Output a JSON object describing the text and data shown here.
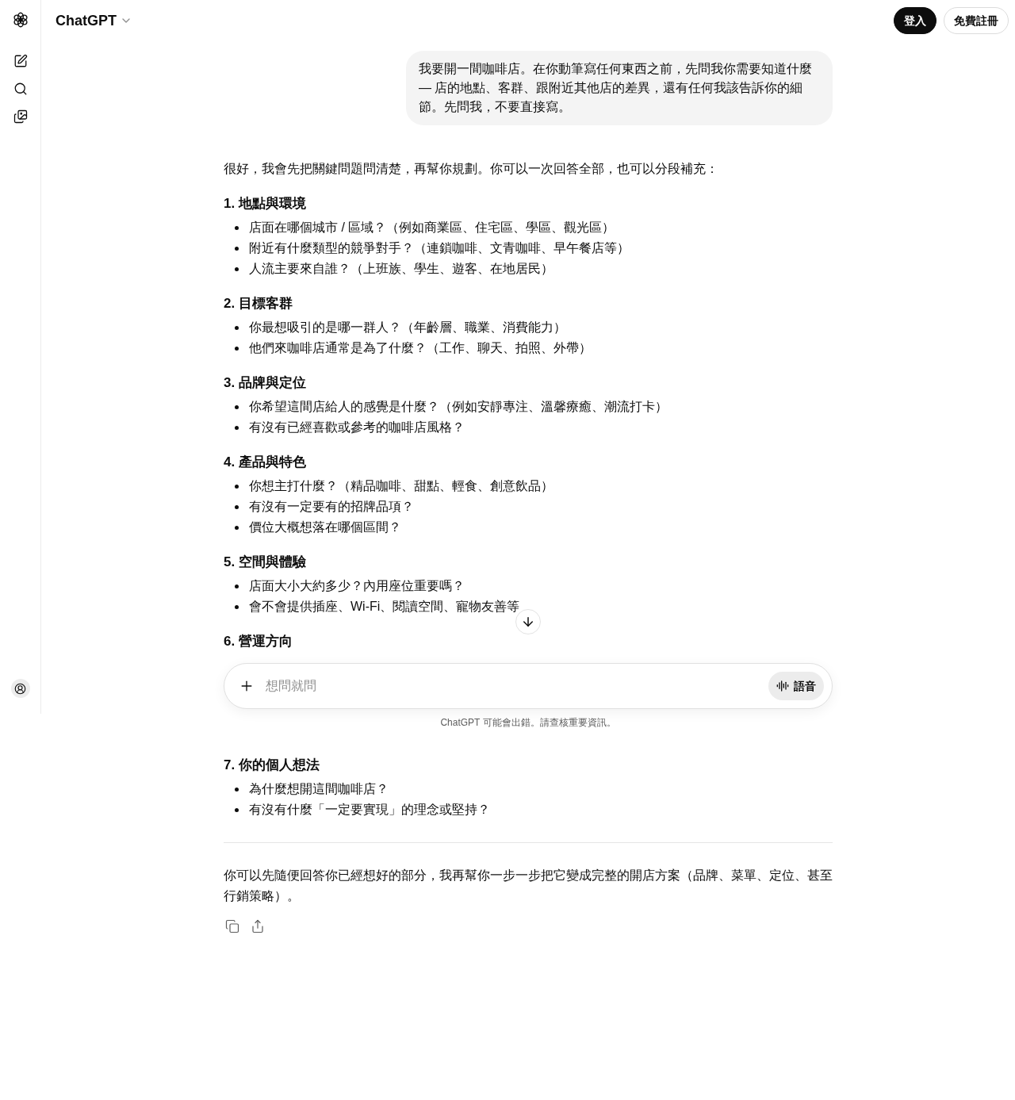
{
  "header": {
    "title": "ChatGPT",
    "buttons": [
      {
        "label": "登入",
        "kind": "primary"
      },
      {
        "label": "免費註冊",
        "kind": "secondary"
      }
    ]
  },
  "user_message": "我要開一間咖啡店。在你動筆寫任何東西之前，先問我你需要知道什麼 — 店的地點、客群、跟附近其他店的差異，還有任何我該告訴你的細節。先問我，不要直接寫。",
  "assistant": {
    "intro": "很好，我會先把關鍵問題問清楚，再幫你規劃。你可以一次回答全部，也可以分段補充：",
    "sections_above": [
      {
        "heading": "1. 地點與環境",
        "items": [
          "店面在哪個城市 / 區域？（例如商業區、住宅區、學區、觀光區）",
          "附近有什麼類型的競爭對手？（連鎖咖啡、文青咖啡、早午餐店等）",
          "人流主要來自誰？（上班族、學生、遊客、在地居民）"
        ]
      },
      {
        "heading": "2. 目標客群",
        "items": [
          "你最想吸引的是哪一群人？（年齡層、職業、消費能力）",
          "他們來咖啡店通常是為了什麼？（工作、聊天、拍照、外帶）"
        ]
      },
      {
        "heading": "3. 品牌與定位",
        "items": [
          "你希望這間店給人的感覺是什麼？（例如安靜專注、溫馨療癒、潮流打卡）",
          "有沒有已經喜歡或參考的咖啡店風格？"
        ]
      },
      {
        "heading": "4. 產品與特色",
        "items": [
          "你想主打什麼？（精品咖啡、甜點、輕食、創意飲品）",
          "有沒有一定要有的招牌品項？",
          "價位大概想落在哪個區間？"
        ]
      },
      {
        "heading": "5. 空間與體驗",
        "items": [
          "店面大小大約多少？內用座位重要嗎？",
          "會不會提供插座、Wi-Fi、閱讀空間、寵物友善等"
        ]
      },
      {
        "heading": "6. 營運方向"
      }
    ],
    "sections_below": [
      {
        "heading": "7. 你的個人想法",
        "items": [
          "為什麼想開這間咖啡店？",
          "有沒有什麼「一定要實現」的理念或堅持？"
        ]
      }
    ],
    "outro": "你可以先隨便回答你已經想好的部分，我再幫你一步一步把它變成完整的開店方案（品牌、菜單、定位、甚至行銷策略）。"
  },
  "composer": {
    "placeholder": "想問就問",
    "voice_button": "語音",
    "disclaimer": "ChatGPT 可能會出錯。請查核重要資訊。"
  }
}
